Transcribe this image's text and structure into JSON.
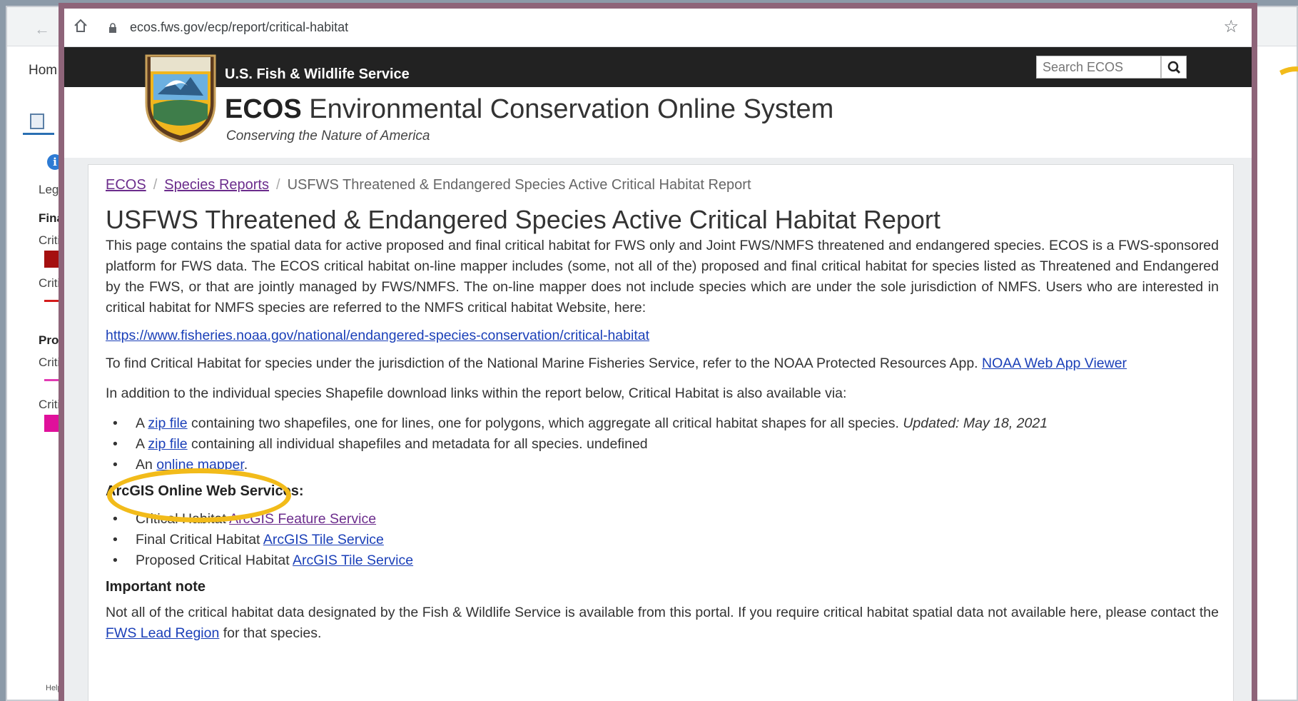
{
  "background_app": {
    "home_label": "Hom",
    "legend_label": "Lege",
    "final_label": "Final",
    "crit1": "Critic",
    "crit2": "Critic",
    "proposed_label": "Prop",
    "crit3": "Critic",
    "crit4": "Critic",
    "help_label": "Help",
    "colors": {
      "final_poly": "#a50f0f",
      "final_line": "#d41b1b",
      "prop_line": "#e23bb3",
      "prop_poly": "#e0109b"
    }
  },
  "browser": {
    "url": "ecos.fws.gov/ecp/report/critical-habitat"
  },
  "header": {
    "agency": "U.S. Fish & Wildlife Service",
    "logo_text": "U.S. FISH & WILDLIFE SERVICE",
    "title_bold": "ECOS",
    "title_rest": " Environmental Conservation Online System",
    "tagline": "Conserving the Nature of America",
    "search_placeholder": "Search ECOS"
  },
  "breadcrumb": {
    "items": [
      "ECOS",
      "Species Reports"
    ],
    "current": "USFWS Threatened & Endangered Species Active Critical Habitat Report"
  },
  "page": {
    "title": "USFWS Threatened & Endangered Species Active Critical Habitat Report",
    "intro": "This page contains the spatial data for active proposed and final critical habitat for FWS only and Joint FWS/NMFS threatened and endangered species. ECOS is a FWS-sponsored platform for FWS data. The ECOS critical habitat on-line mapper includes (some, not all of the) proposed and final critical habitat for species listed as Threatened and Endangered by the FWS, or that are jointly managed by FWS/NMFS. The on-line mapper does not include species which are under the sole jurisdiction of NMFS. Users who are interested in critical habitat for NMFS species are referred to the NMFS critical habitat Website, here:",
    "nmfs_url": "https://www.fisheries.noaa.gov/national/endangered-species-conservation/critical-habitat",
    "noaa_text": "To find Critical Habitat for species under the jurisdiction of the National Marine Fisheries Service, refer to the NOAA Protected Resources App.",
    "noaa_link": "NOAA Web App Viewer",
    "also_text": "In addition to the individual species Shapefile download links within the report below, Critical Habitat is also available via:",
    "downloads": {
      "a1": "A",
      "zip1": "zip file",
      "zip1_rest": " containing two shapefiles, one for lines, one for polygons, which aggregate all critical habitat shapes for all species.",
      "updated": "Updated: May 18, 2021",
      "a2": "A",
      "zip2": "zip file",
      "zip2_rest": " containing all individual shapefiles and metadata for all species. undefined",
      "an": "An",
      "mapper": "online mapper",
      "period": "."
    },
    "arcgis_heading": "ArcGIS Online Web Services:",
    "services": [
      {
        "prefix": "Critical Habitat",
        "link": "ArcGIS Feature Service"
      },
      {
        "prefix": "Final Critical Habitat",
        "link": "ArcGIS Tile Service"
      },
      {
        "prefix": "Proposed Critical Habitat",
        "link": "ArcGIS Tile Service"
      }
    ],
    "note_heading": "Important note",
    "note_text": "Not all of the critical habitat data designated by the Fish & Wildlife Service is available from this portal. If you require critical habitat spatial data not available here, please contact the",
    "note_link": "FWS Lead Region",
    "note_end": " for that species."
  },
  "colors": {
    "highlight": "#f2bb1a",
    "window_border": "#8e6479",
    "link": "#1a3fb8",
    "visited": "#6b2c8c"
  }
}
